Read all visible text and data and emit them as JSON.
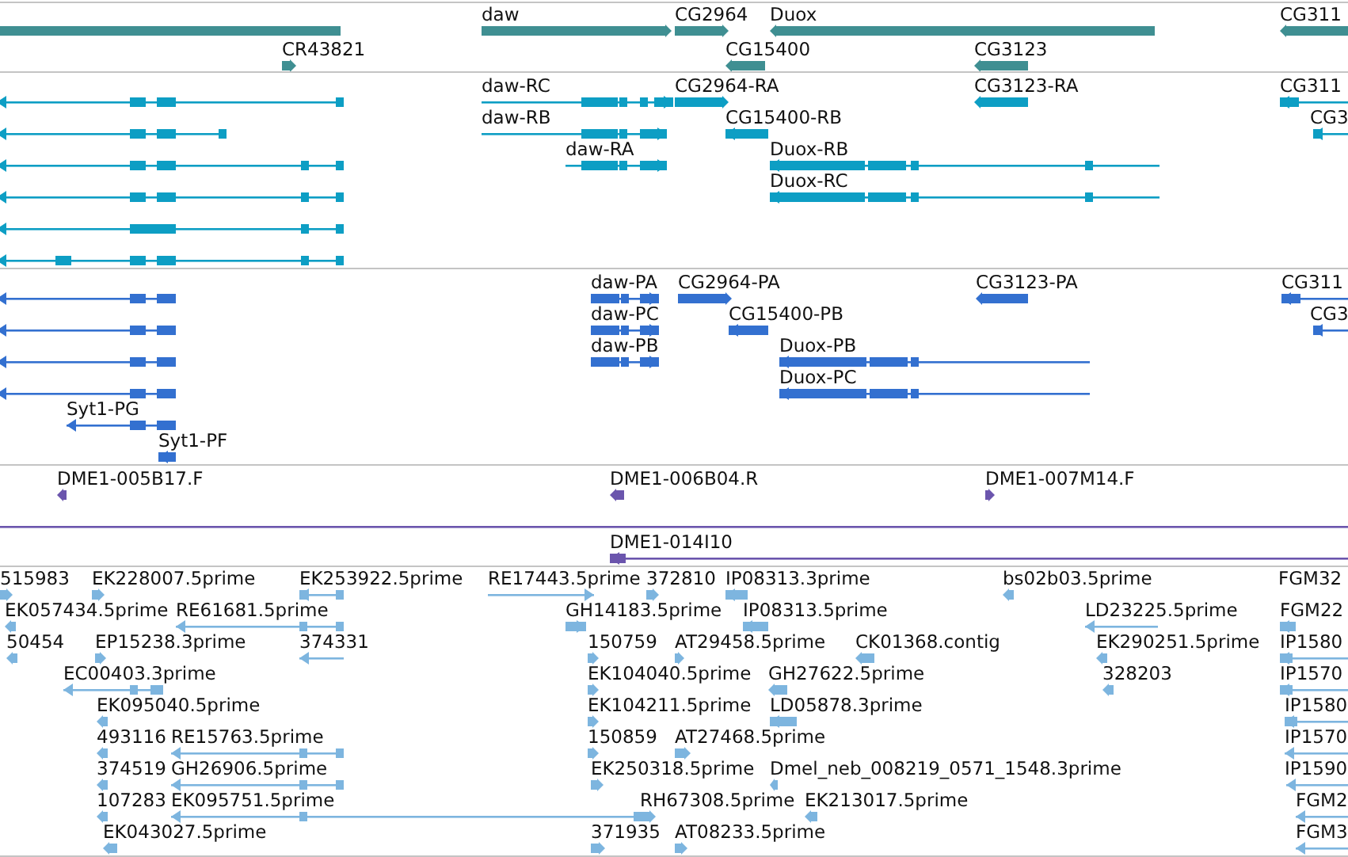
{
  "tracks": [
    {
      "color": "#3f8f92",
      "features": [
        {
          "forward": false
        },
        {
          "label": "daw",
          "forward": true
        },
        {
          "label": "CG2964",
          "forward": true
        },
        {
          "label": "Duox",
          "forward": false
        },
        {
          "label": "CG311",
          "forward": false
        },
        {
          "label": "CR43821",
          "forward": true
        },
        {
          "label": "CG15400",
          "forward": false
        },
        {
          "label": "CG3123",
          "forward": false
        }
      ]
    },
    {
      "color": "#0d9ec4",
      "features": [
        {
          "forward": false
        },
        {
          "label": "daw-RC",
          "forward": true
        },
        {
          "label": "CG2964-RA",
          "forward": true
        },
        {
          "label": "CG3123-RA",
          "forward": false
        },
        {
          "label": "CG311",
          "forward": false
        },
        {
          "forward": false
        },
        {
          "label": "daw-RB",
          "forward": true
        },
        {
          "label": "CG15400-RB",
          "forward": false
        },
        {
          "label": "CG3",
          "forward": false
        },
        {
          "forward": false
        },
        {
          "label": "daw-RA",
          "forward": true
        },
        {
          "label": "Duox-RB",
          "forward": false
        },
        {
          "forward": false
        },
        {
          "label": "Duox-RC",
          "forward": false
        },
        {
          "forward": false
        },
        {
          "forward": false
        }
      ]
    },
    {
      "color": "#3370d0",
      "features": [
        {
          "forward": false
        },
        {
          "label": "daw-PA",
          "forward": true
        },
        {
          "label": "CG2964-PA",
          "forward": true
        },
        {
          "label": "CG3123-PA",
          "forward": false
        },
        {
          "label": "CG311",
          "forward": false
        },
        {
          "forward": false
        },
        {
          "label": "daw-PC",
          "forward": true
        },
        {
          "label": "CG15400-PB",
          "forward": false
        },
        {
          "label": "CG3",
          "forward": false
        },
        {
          "forward": false
        },
        {
          "label": "daw-PB",
          "forward": true
        },
        {
          "label": "Duox-PB",
          "forward": false
        },
        {
          "forward": false
        },
        {
          "label": "Duox-PC",
          "forward": false
        },
        {
          "label": "Syt1-PG",
          "forward": false
        },
        {
          "label": "Syt1-PF",
          "forward": false
        }
      ]
    },
    {
      "color": "#6b55ad",
      "features": [
        {
          "label": "DME1-005B17.F",
          "forward": false
        },
        {
          "label": "DME1-006B04.R",
          "forward": false
        },
        {
          "label": "DME1-007M14.F",
          "forward": true
        },
        {
          "forward": false
        },
        {
          "label": "DME1-014I10",
          "forward": false
        }
      ]
    },
    {
      "color": "#7db5df",
      "features": [
        {
          "label": "515983",
          "forward": true
        },
        {
          "label": "EK228007.5prime",
          "forward": true
        },
        {
          "label": "EK253922.5prime",
          "forward": false
        },
        {
          "label": "RE17443.5prime",
          "forward": true
        },
        {
          "label": "372810",
          "forward": true
        },
        {
          "label": "IP08313.3prime",
          "forward": false
        },
        {
          "label": "bs02b03.5prime",
          "forward": false
        },
        {
          "label": "FGM32"
        },
        {
          "label": "EK057434.5prime",
          "forward": false
        },
        {
          "label": "RE61681.5prime",
          "forward": false
        },
        {
          "label": "GH14183.5prime",
          "forward": true
        },
        {
          "label": "IP08313.5prime",
          "forward": false
        },
        {
          "label": "LD23225.5prime",
          "forward": false
        },
        {
          "label": "FGM22",
          "forward": false
        },
        {
          "label": "50454",
          "forward": false
        },
        {
          "label": "EP15238.3prime",
          "forward": true
        },
        {
          "label": "374331",
          "forward": false
        },
        {
          "label": "150759",
          "forward": true
        },
        {
          "label": "AT29458.5prime",
          "forward": true
        },
        {
          "label": "CK01368.contig",
          "forward": false
        },
        {
          "label": "EK290251.5prime",
          "forward": false
        },
        {
          "label": "IP1580",
          "forward": false
        },
        {
          "label": "EC00403.3prime",
          "forward": false
        },
        {
          "label": "EK104040.5prime",
          "forward": true
        },
        {
          "label": "GH27622.5prime",
          "forward": false
        },
        {
          "label": "328203",
          "forward": false
        },
        {
          "label": "IP1570",
          "forward": false
        },
        {
          "label": "EK095040.5prime",
          "forward": false
        },
        {
          "label": "EK104211.5prime",
          "forward": true
        },
        {
          "label": "LD05878.3prime",
          "forward": false
        },
        {
          "label": "IP1580",
          "forward": false
        },
        {
          "label": "493116",
          "forward": false
        },
        {
          "label": "RE15763.5prime",
          "forward": false
        },
        {
          "label": "150859",
          "forward": true
        },
        {
          "label": "AT27468.5prime",
          "forward": true
        },
        {
          "label": "IP1570",
          "forward": false
        },
        {
          "label": "374519",
          "forward": false
        },
        {
          "label": "GH26906.5prime",
          "forward": false
        },
        {
          "label": "EK250318.5prime",
          "forward": true
        },
        {
          "label": "Dmel_neb_008219_0571_1548.3prime",
          "forward": false
        },
        {
          "label": "IP1590",
          "forward": false
        },
        {
          "label": "107283",
          "forward": false
        },
        {
          "label": "EK095751.5prime",
          "forward": false
        },
        {
          "label": "RH67308.5prime",
          "forward": true
        },
        {
          "label": "EK213017.5prime",
          "forward": false
        },
        {
          "label": "FGM2",
          "forward": false
        },
        {
          "label": "EK043027.5prime",
          "forward": false
        },
        {
          "label": "371935",
          "forward": true
        },
        {
          "label": "AT08233.5prime",
          "forward": true
        },
        {
          "label": "FGM3",
          "forward": false
        }
      ]
    }
  ]
}
